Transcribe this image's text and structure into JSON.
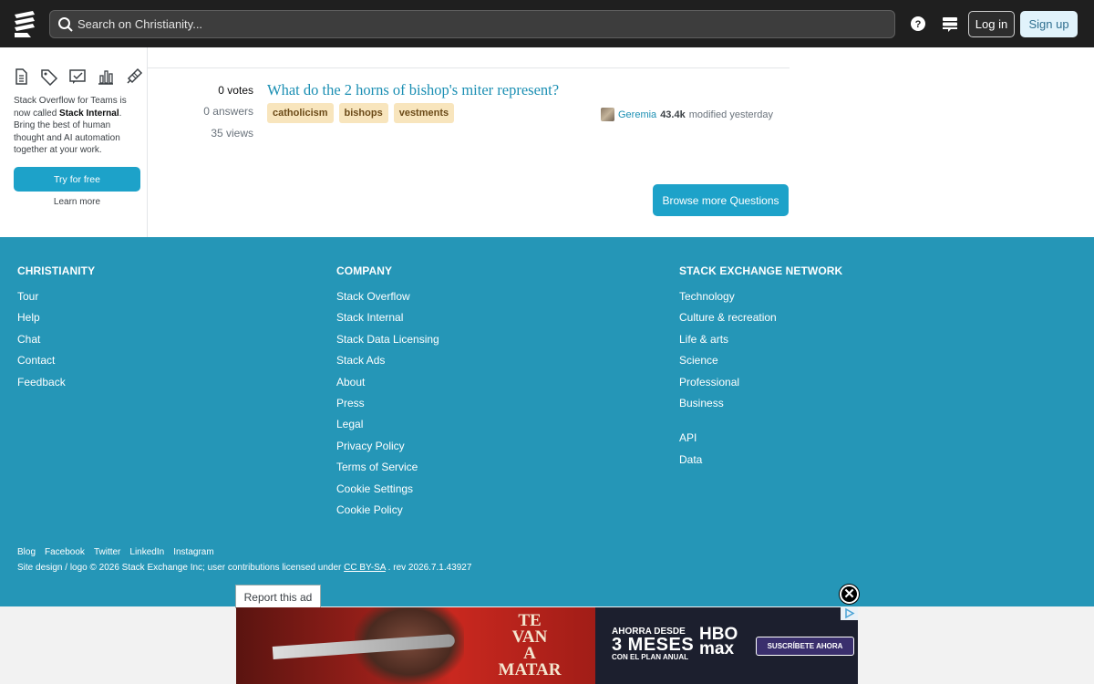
{
  "header": {
    "search_placeholder": "Search on Christianity...",
    "login_label": "Log in",
    "signup_label": "Sign up"
  },
  "sidebar": {
    "icons": [
      "questions-icon",
      "tags-icon",
      "chat-icon",
      "chart-icon",
      "badge-icon"
    ],
    "promo_text_1": "Stack Overflow for Teams is now called ",
    "promo_bold": "Stack Internal",
    "promo_text_2": ". Bring the best of human thought and AI automation together at your work.",
    "try_label": "Try for free",
    "learn_label": "Learn more"
  },
  "question": {
    "votes": "0 votes",
    "answers": "0 answers",
    "views": "35 views",
    "title": "What do the 2 horns of bishop's miter represent?",
    "tags": [
      "catholicism",
      "bishops",
      "vestments"
    ],
    "user_name": "Geremia",
    "user_rep": "43.4k",
    "modified": "modified yesterday"
  },
  "browse_label": "Browse more Questions",
  "footer": {
    "col1": {
      "heading": "CHRISTIANITY",
      "links": [
        "Tour",
        "Help",
        "Chat",
        "Contact",
        "Feedback"
      ]
    },
    "col2": {
      "heading": "COMPANY",
      "links": [
        "Stack Overflow",
        "Stack Internal",
        "Stack Data Licensing",
        "Stack Ads",
        "About",
        "Press",
        "Legal",
        "Privacy Policy",
        "Terms of Service",
        "Cookie Settings",
        "Cookie Policy"
      ]
    },
    "col3": {
      "heading": "STACK EXCHANGE NETWORK",
      "links": [
        "Technology",
        "Culture & recreation",
        "Life & arts",
        "Science",
        "Professional",
        "Business"
      ],
      "links2": [
        "API",
        "Data"
      ]
    },
    "social": [
      "Blog",
      "Facebook",
      "Twitter",
      "LinkedIn",
      "Instagram"
    ],
    "copy_prefix": "Site design / logo © 2026 Stack Exchange Inc; user contributions licensed under ",
    "copy_license": "CC BY-SA",
    "copy_suffix": " . rev 2026.7.1.43927"
  },
  "ad": {
    "report_label": "Report this ad",
    "close_label": "✕",
    "movie_title_1": "TE",
    "movie_title_2": "VAN",
    "movie_title_3": "A",
    "movie_title_4": "MATAR",
    "promo_line1": "AHORRA DESDE",
    "promo_line2": "3 MESES",
    "promo_line3": "CON EL PLAN ANUAL",
    "brand_1": "HBO",
    "brand_2": "max",
    "cta": "SUSCRÍBETE AHORA"
  },
  "colors": {
    "accent": "#1da2c9",
    "footer_bg": "#2596b7",
    "tag_bg": "#f8e5bd",
    "link": "#1b8fb3",
    "topbar": "#1f1f1f"
  }
}
